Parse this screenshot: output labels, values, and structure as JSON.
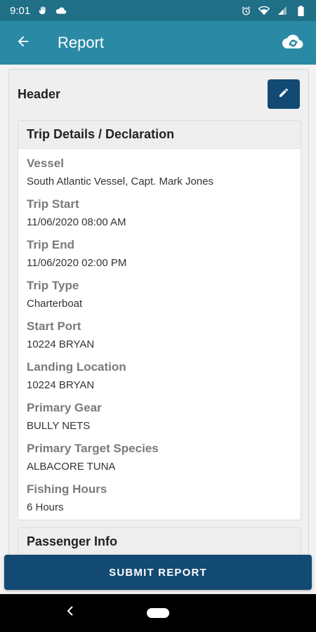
{
  "status_bar": {
    "time": "9:01",
    "icons": [
      "hand-icon",
      "cloud-icon",
      "alarm-icon",
      "wifi-icon",
      "signal-icon",
      "battery-icon"
    ]
  },
  "app_bar": {
    "title": "Report",
    "back_icon": "arrow-left-icon",
    "sync_icon": "cloud-sync-icon"
  },
  "header_card": {
    "title": "Header",
    "edit_icon": "pencil-icon"
  },
  "trip_details": {
    "title": "Trip Details / Declaration",
    "fields": [
      {
        "label": "Vessel",
        "value": "South Atlantic Vessel, Capt. Mark Jones"
      },
      {
        "label": "Trip Start",
        "value": "11/06/2020 08:00 AM"
      },
      {
        "label": "Trip End",
        "value": "11/06/2020 02:00 PM"
      },
      {
        "label": "Trip Type",
        "value": "Charterboat"
      },
      {
        "label": "Start Port",
        "value": "10224 BRYAN"
      },
      {
        "label": "Landing Location",
        "value": "10224 BRYAN"
      },
      {
        "label": "Primary Gear",
        "value": "BULLY NETS"
      },
      {
        "label": "Primary Target Species",
        "value": "ALBACORE TUNA"
      },
      {
        "label": "Fishing Hours",
        "value": "6 Hours"
      }
    ]
  },
  "passenger_info": {
    "title": "Passenger Info"
  },
  "submit": {
    "label": "SUBMIT REPORT"
  },
  "colors": {
    "status_bar": "#1f6f86",
    "app_bar": "#2a8aa6",
    "primary_button": "#124a73"
  }
}
